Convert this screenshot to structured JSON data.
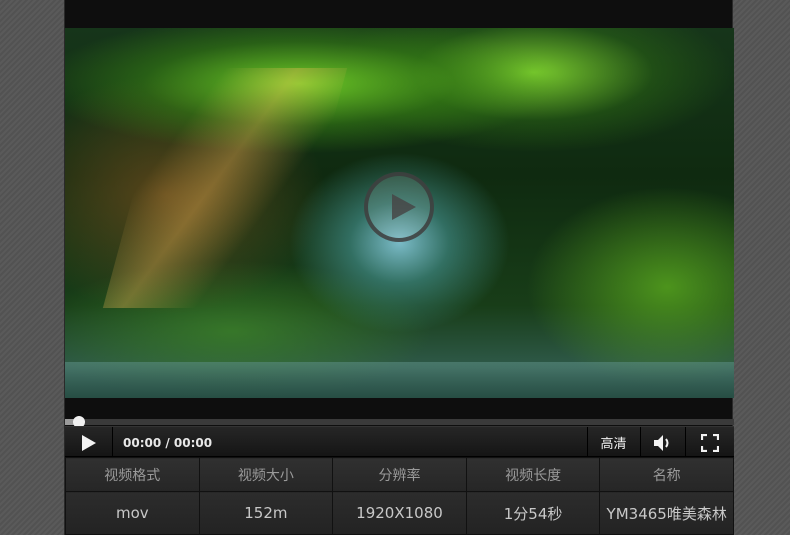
{
  "player": {
    "time_display": "00:00 / 00:00",
    "quality_label": "高清",
    "progress_fraction": 0.0,
    "icons": {
      "overlay": "play-circle-icon",
      "play": "play-icon",
      "volume": "volume-icon",
      "fullscreen": "fullscreen-icon"
    }
  },
  "info_table": {
    "headers": [
      "视频格式",
      "视频大小",
      "分辨率",
      "视频长度",
      "名称"
    ],
    "values": [
      "mov",
      "152m",
      "1920X1080",
      "1分54秒",
      "YM3465唯美森林"
    ]
  }
}
